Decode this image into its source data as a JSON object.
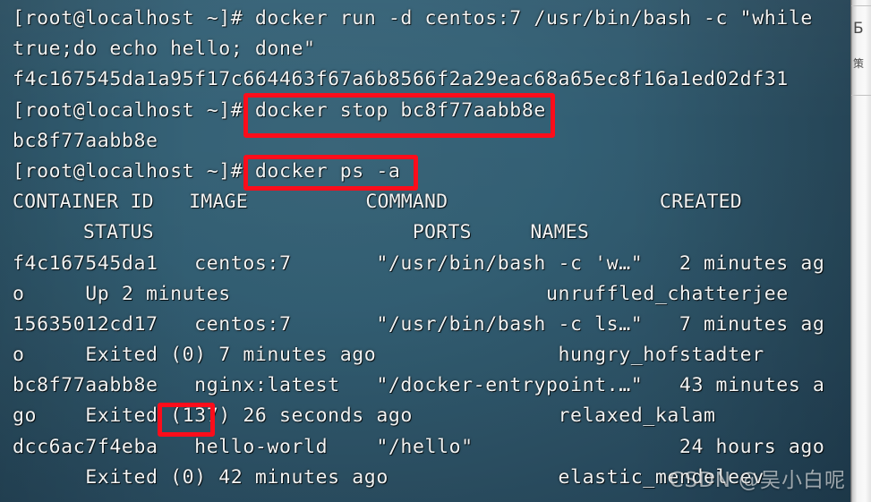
{
  "terminal": {
    "prompt": "[root@localhost ~]#",
    "lines": [
      {
        "id": "cmd-docker-run-1",
        "text": "[root@localhost ~]# docker run -d centos:7 /usr/bin/bash -c \"while"
      },
      {
        "id": "cmd-docker-run-2",
        "text": "true;do echo hello; done\""
      },
      {
        "id": "output-container-id",
        "text": "f4c167545da1a95f17c664463f67a6b8566f2a29eac68a65ec8f16a1ed02df31"
      },
      {
        "id": "cmd-docker-stop",
        "text": "[root@localhost ~]# docker stop bc8f77aabb8e"
      },
      {
        "id": "output-stopped-id",
        "text": "bc8f77aabb8e"
      },
      {
        "id": "cmd-docker-ps-a",
        "text": "[root@localhost ~]# docker ps -a"
      },
      {
        "id": "table-header-1",
        "text": "CONTAINER ID   IMAGE          COMMAND                  CREATED",
        "header": true
      },
      {
        "id": "table-header-2",
        "text": "      STATUS                      PORTS     NAMES",
        "header": true
      },
      {
        "id": "row-1-line-1",
        "text": "f4c167545da1   centos:7       \"/usr/bin/bash -c 'w…\"   2 minutes ag"
      },
      {
        "id": "row-1-line-2",
        "text": "o     Up 2 minutes                          unruffled_chatterjee"
      },
      {
        "id": "row-2-line-1",
        "text": "15635012cd17   centos:7       \"/usr/bin/bash -c ls…\"   7 minutes ag"
      },
      {
        "id": "row-2-line-2",
        "text": "o     Exited (0) 7 minutes ago               hungry_hofstadter"
      },
      {
        "id": "row-3-line-1",
        "text": "bc8f77aabb8e   nginx:latest   \"/docker-entrypoint.…\"   43 minutes a"
      },
      {
        "id": "row-3-line-2",
        "text": "go    Exited (137) 26 seconds ago            relaxed_kalam"
      },
      {
        "id": "row-4-line-1",
        "text": "dcc6ac7f4eba   hello-world    \"/hello\"                 24 hours ago"
      },
      {
        "id": "row-4-line-2",
        "text": "      Exited (0) 42 minutes ago              elastic_mendeleev"
      }
    ]
  },
  "table": {
    "columns": [
      "CONTAINER ID",
      "IMAGE",
      "COMMAND",
      "CREATED",
      "STATUS",
      "PORTS",
      "NAMES"
    ],
    "rows": [
      {
        "container_id": "f4c167545da1",
        "image": "centos:7",
        "command": "\"/usr/bin/bash -c 'w…\"",
        "created": "2 minutes ago",
        "status": "Up 2 minutes",
        "ports": "",
        "names": "unruffled_chatterjee"
      },
      {
        "container_id": "15635012cd17",
        "image": "centos:7",
        "command": "\"/usr/bin/bash -c ls…\"",
        "created": "7 minutes ago",
        "status": "Exited (0) 7 minutes ago",
        "ports": "",
        "names": "hungry_hofstadter"
      },
      {
        "container_id": "bc8f77aabb8e",
        "image": "nginx:latest",
        "command": "\"/docker-entrypoint.…\"",
        "created": "43 minutes ago",
        "status": "Exited (137) 26 seconds ago",
        "ports": "",
        "names": "relaxed_kalam"
      },
      {
        "container_id": "dcc6ac7f4eba",
        "image": "hello-world",
        "command": "\"/hello\"",
        "created": "24 hours ago",
        "status": "Exited (0) 42 minutes ago",
        "ports": "",
        "names": "elastic_mendeleev"
      }
    ]
  },
  "annotations": {
    "box_color": "#fc0d1b",
    "items": [
      {
        "id": "stop-command",
        "label": "docker stop bc8f77aabb8e"
      },
      {
        "id": "ps-command",
        "label": "docker ps -a"
      },
      {
        "id": "exit-code-137",
        "label": "(137)"
      }
    ]
  },
  "right_strip": {
    "glyph_top": "Б",
    "glyph_bottom": "策"
  },
  "watermark": {
    "brand": "CSDN",
    "author": "@吴小白呢"
  }
}
